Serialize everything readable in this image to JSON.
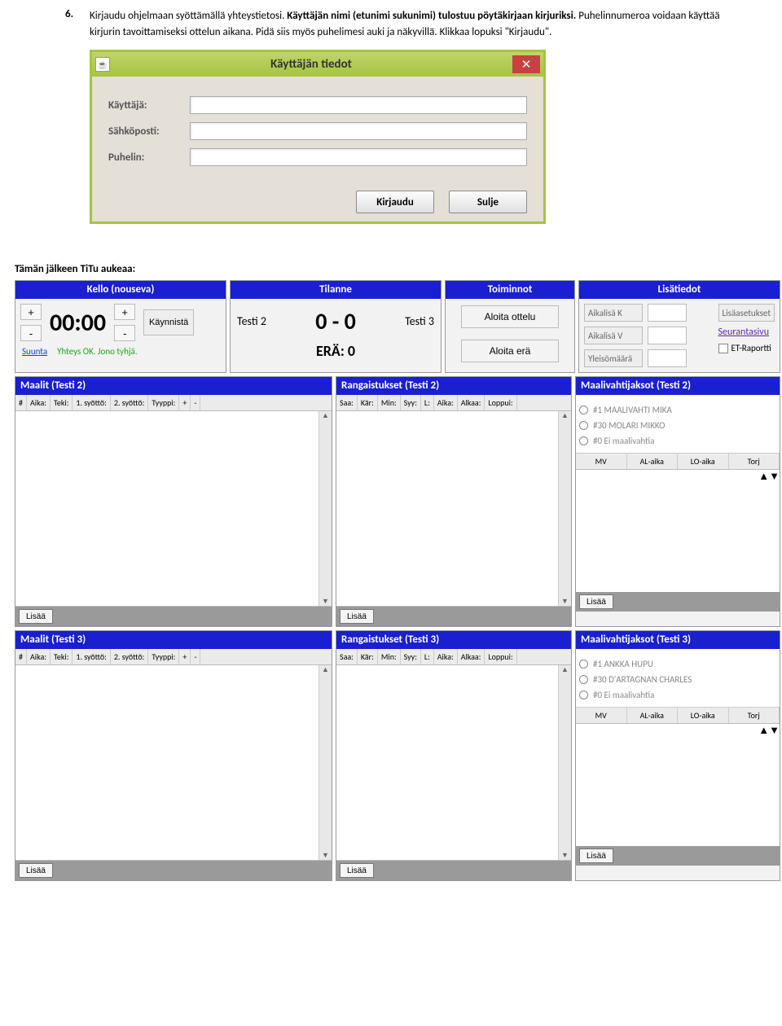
{
  "doc": {
    "num": "6.",
    "line1a": "Kirjaudu ohjelmaan syöttämällä yhteystietosi. ",
    "line1b": "Käyttäjän nimi (etunimi sukunimi) tulostuu pöytäkirjaan kirjuriksi.",
    "line2a": " Puhelinnumeroa voidaan käyttää kirjurin tavoittamiseksi ottelun aikana. Pidä siis myös puhelimesi auki ja näkyvillä. Klikkaa lopuksi \"Kirjaudu\"."
  },
  "login": {
    "title": "Käyttäjän tiedot",
    "labels": {
      "user": "Käyttäjä:",
      "email": "Sähköposti:",
      "phone": "Puhelin:"
    },
    "buttons": {
      "login": "Kirjaudu",
      "close": "Sulje"
    }
  },
  "afterTitle": "Tämän jälkeen TiTu aukeaa:",
  "clockPanel": {
    "title": "Kello (nouseva)",
    "time": "00:00",
    "start": "Käynnistä",
    "dirLink": "Suunta",
    "connStatus": "Yhteys OK. Jono tyhjä."
  },
  "statusPanel": {
    "title": "Tilanne",
    "home": "Testi 2",
    "score": "0 - 0",
    "away": "Testi 3",
    "period": "ERÄ: 0"
  },
  "actionsPanel": {
    "title": "Toiminnot",
    "startMatch": "Aloita ottelu",
    "startPeriod": "Aloita erä"
  },
  "extraPanel": {
    "title": "Lisätiedot",
    "timeoutHome": "Aikalisä K",
    "timeoutAway": "Aikalisä V",
    "attendance": "Yleisömäärä",
    "extraSettings": "Lisäasetukset",
    "trackingPage": "Seurantasivu",
    "etReport": "ET-Raportti"
  },
  "goalsHeaders": [
    "#",
    "Aika:",
    "Teki:",
    "1. syöttö:",
    "2. syöttö:",
    "Tyyppi:",
    "+",
    "-"
  ],
  "penaltyHeaders": [
    "Saa:",
    "Kär:",
    "Min:",
    "Syy:",
    "L:",
    "Aika:",
    "Alkaa:",
    "Loppui:"
  ],
  "goalieHeaders": [
    "MV",
    "AL-aika",
    "LO-aika",
    "Torj"
  ],
  "addBtn": "Lisää",
  "panelsTeam2": {
    "goals": "Maalit (Testi 2)",
    "penalties": "Rangaistukset (Testi 2)",
    "goaliePeriods": "Maalivahtijaksot (Testi 2)",
    "goalies": [
      "#1 MAALIVAHTI MIKA",
      "#30 MOLARI MIKKO",
      "#0 Ei maalivahtia"
    ]
  },
  "panelsTeam3": {
    "goals": "Maalit (Testi 3)",
    "penalties": "Rangaistukset (Testi 3)",
    "goaliePeriods": "Maalivahtijaksot (Testi 3)",
    "goalies": [
      "#1 ANKKA HUPU",
      "#30 D'ARTAGNAN CHARLES",
      "#0 Ei maalivahtia"
    ]
  }
}
